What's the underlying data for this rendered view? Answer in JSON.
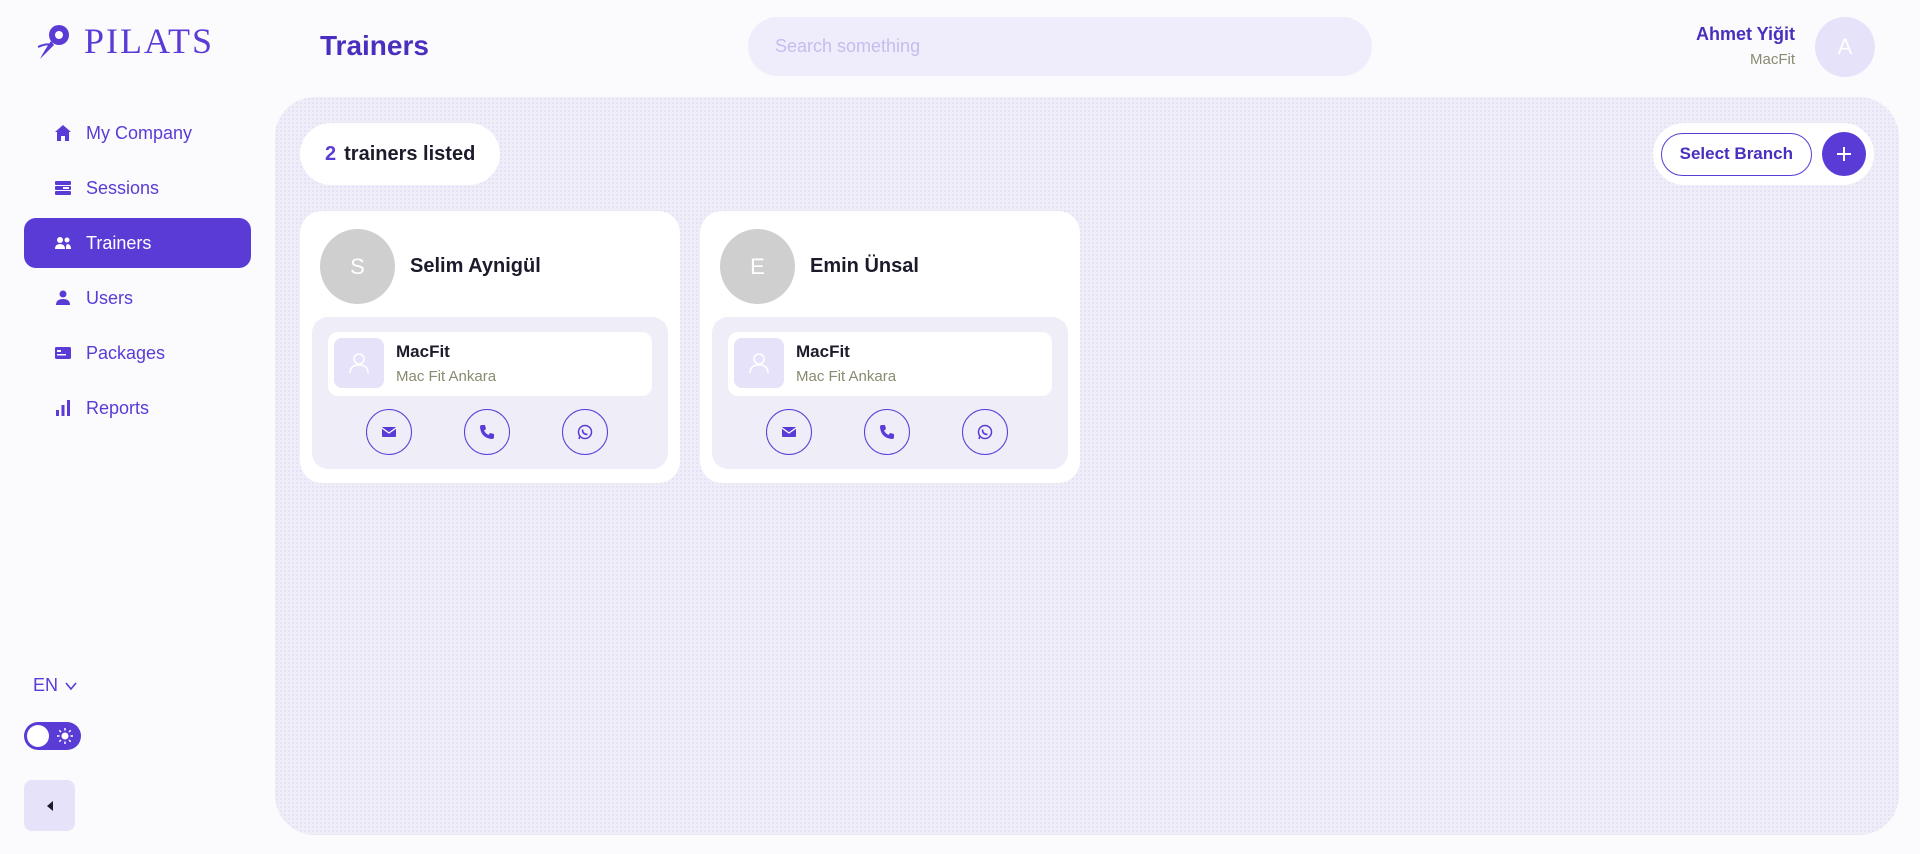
{
  "app": {
    "logo_text": "PILATS"
  },
  "sidebar": {
    "items": [
      {
        "label": "My Company",
        "icon": "home-icon",
        "active": false
      },
      {
        "label": "Sessions",
        "icon": "sessions-icon",
        "active": false
      },
      {
        "label": "Trainers",
        "icon": "trainers-icon",
        "active": true
      },
      {
        "label": "Users",
        "icon": "user-icon",
        "active": false
      },
      {
        "label": "Packages",
        "icon": "packages-icon",
        "active": false
      },
      {
        "label": "Reports",
        "icon": "reports-icon",
        "active": false
      }
    ],
    "language": "EN",
    "theme_toggle": "light"
  },
  "header": {
    "title": "Trainers",
    "search_placeholder": "Search something",
    "user": {
      "name": "Ahmet Yiğit",
      "company": "MacFit",
      "avatar_initial": "A"
    }
  },
  "main": {
    "count": "2",
    "count_label": "trainers listed",
    "select_branch_label": "Select Branch",
    "trainers": [
      {
        "initial": "S",
        "name": "Selim Aynigül",
        "branch": {
          "name": "MacFit",
          "location": "Mac Fit Ankara"
        }
      },
      {
        "initial": "E",
        "name": "Emin Ünsal",
        "branch": {
          "name": "MacFit",
          "location": "Mac Fit Ankara"
        }
      }
    ]
  },
  "colors": {
    "accent": "#5b3bd6",
    "accent_light": "#e6e2fa",
    "panel": "#efedf8"
  }
}
